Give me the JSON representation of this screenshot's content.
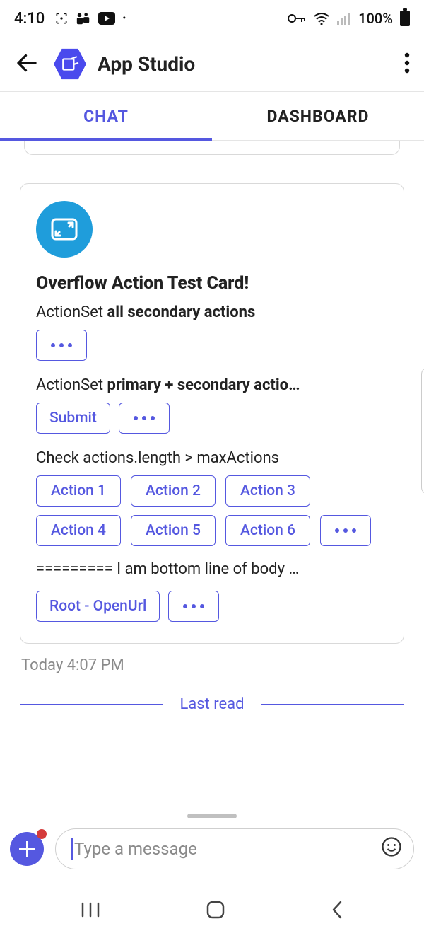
{
  "status": {
    "time": "4:10",
    "battery_pct": "100%"
  },
  "appbar": {
    "title": "App Studio"
  },
  "tabs": {
    "chat": "CHAT",
    "dashboard": "DASHBOARD"
  },
  "card": {
    "title": "Overflow Action Test Card!",
    "section1_label_plain": "ActionSet ",
    "section1_label_bold": "all secondary actions",
    "section2_label_plain": "ActionSet ",
    "section2_label_bold": "primary + secondary actio…",
    "submit_label": "Submit",
    "section3_label": "Check actions.length > maxActions",
    "actions": [
      "Action 1",
      "Action 2",
      "Action 3",
      "Action 4",
      "Action 5",
      "Action 6"
    ],
    "bottom_line": "========= I am bottom line of body …",
    "root_openurl_label": "Root - OpenUrl"
  },
  "timestamp": "Today 4:07 PM",
  "last_read": "Last read",
  "composer": {
    "placeholder": "Type a message"
  }
}
